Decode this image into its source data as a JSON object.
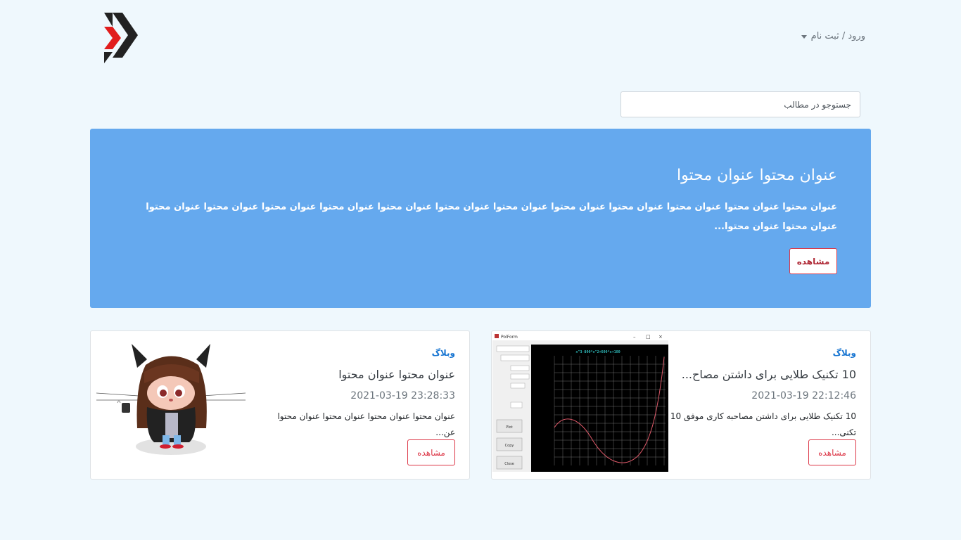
{
  "header": {
    "logo": "brand-chevrons-logo",
    "auth_label": "ورود / ثبت نام"
  },
  "search": {
    "placeholder": "جستوجو در مطالب"
  },
  "hero": {
    "title": "عنوان محتوا عنوان محتوا",
    "excerpt": "عنوان محتوا عنوان محتوا عنوان محتوا عنوان محتوا عنوان محتوا عنوان محتوا عنوان محتوا عنوان محتوا عنوان محتوا عنوان محتوا عنوان محتوا عنوان محتوا عنوان محتوا عنوان محتوا...",
    "button_label": "مشاهده"
  },
  "cards": [
    {
      "category": "وبلاگ",
      "title": "10 تکنیک طلایی برای داشتن مصاح...",
      "date": "2021-03-19 22:12:46",
      "excerpt": "10 تکنیک طلایی برای داشتن مصاحبه کاری موفق 10 تکنی...",
      "button_label": "مشاهده",
      "image": "plot-window-screenshot",
      "plot_title": "x^3-800*x^2+600*x+100",
      "window_title": "PolForm",
      "buttons": [
        "Plot",
        "Copy",
        "Close"
      ]
    },
    {
      "category": "وبلاگ",
      "title": "عنوان محتوا عنوان محتوا",
      "date": "2021-03-19 23:28:33",
      "excerpt": "عنوان محتوا عنوان محتوا عنوان محتوا عنوان محتوا عن...",
      "button_label": "مشاهده",
      "image": "octocat-illustration"
    }
  ],
  "colors": {
    "page_bg": "#eff8fd",
    "hero_bg": "#65a9ee",
    "accent_red": "#dc3545",
    "link_blue": "#1976d2"
  }
}
